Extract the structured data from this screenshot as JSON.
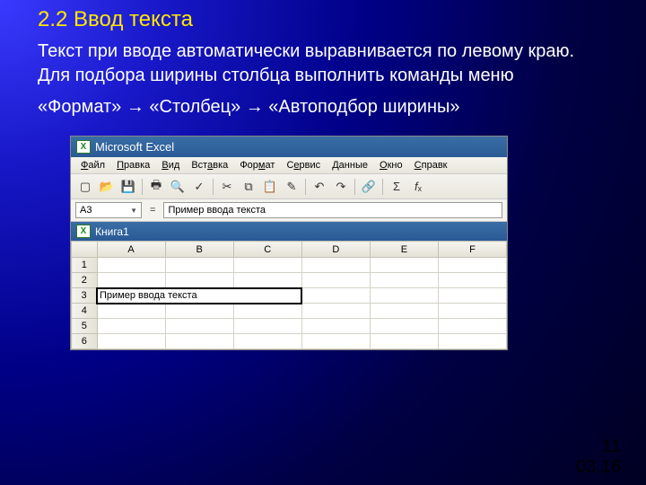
{
  "slide": {
    "title": "2.2 Ввод текста",
    "body": "Текст при вводе автоматически выравнивается по левому краю. Для подбора ширины столбца выполнить команды меню",
    "path": "«Формат» → «Столбец» → «Автоподбор ширины»"
  },
  "excel": {
    "app_title": "Microsoft Excel",
    "menus": [
      "Файл",
      "Правка",
      "Вид",
      "Вставка",
      "Формат",
      "Сервис",
      "Данные",
      "Окно",
      "Справк"
    ],
    "namebox": "A3",
    "fx_label": "=",
    "formula_value": "Пример ввода текста",
    "book_title": "Книга1",
    "columns": [
      "A",
      "B",
      "C",
      "D",
      "E",
      "F"
    ],
    "rows": [
      "1",
      "2",
      "3",
      "4",
      "5",
      "6"
    ],
    "cell_a3": "Пример ввода текста"
  },
  "footer": {
    "page": "11",
    "date": "03.16"
  }
}
